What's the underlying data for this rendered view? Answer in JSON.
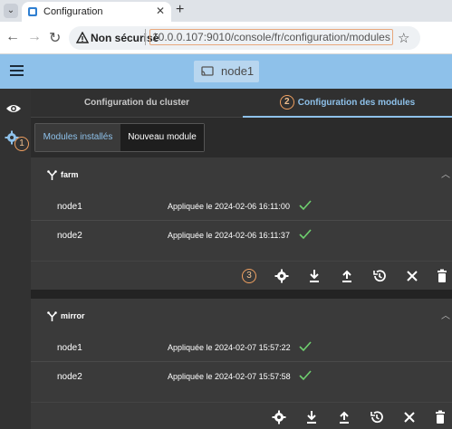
{
  "browser": {
    "tab_title": "Configuration",
    "security_label": "Non sécurisé",
    "url": "10.0.0.107:9010/console/fr/configuration/modules"
  },
  "app": {
    "node_name": "node1"
  },
  "tabs": {
    "cluster": "Configuration du cluster",
    "modules": "Configuration des modules"
  },
  "subtabs": {
    "installed": "Modules installés",
    "new": "Nouveau module"
  },
  "badges": {
    "b1": "1",
    "b2": "2",
    "b3": "3"
  },
  "modules": [
    {
      "name": "farm",
      "rows": [
        {
          "node": "node1",
          "status": "Appliquée le 2024-02-06 16:11:00"
        },
        {
          "node": "node2",
          "status": "Appliquée le 2024-02-06 16:11:37"
        }
      ]
    },
    {
      "name": "mirror",
      "rows": [
        {
          "node": "node1",
          "status": "Appliquée le 2024-02-07 15:57:22"
        },
        {
          "node": "node2",
          "status": "Appliquée le 2024-02-07 15:57:58"
        }
      ]
    }
  ],
  "icons": {
    "actions": [
      "gear-icon",
      "download-icon",
      "upload-icon",
      "history-icon",
      "close-icon",
      "delete-icon"
    ]
  },
  "colors": {
    "accent": "#8ec1ea",
    "header": "#8ec1ea",
    "check": "#6fcf6f",
    "badge": "#f0a060"
  }
}
